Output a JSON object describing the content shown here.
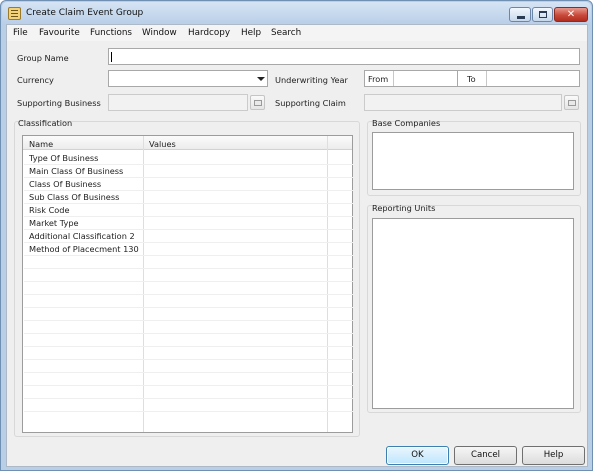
{
  "window": {
    "title": "Create Claim Event Group",
    "controls": {
      "minimize_icon": "minimize-icon",
      "maximize_icon": "maximize-icon",
      "close_icon": "close-icon"
    }
  },
  "menu": [
    "File",
    "Favourite",
    "Functions",
    "Window",
    "Hardcopy",
    "Help",
    "Search"
  ],
  "form": {
    "group_name_label": "Group Name",
    "group_name_value": "",
    "currency_label": "Currency",
    "currency_value": "",
    "underwriting_year_label": "Underwriting Year",
    "from_label": "From",
    "from_value": "",
    "to_label": "To",
    "to_value": "",
    "supporting_business_label": "Supporting Business",
    "supporting_claim_label": "Supporting Claim"
  },
  "classification": {
    "title": "Classification",
    "columns": [
      "Name",
      "Values"
    ],
    "rows": [
      {
        "name": "Type Of Business",
        "value": ""
      },
      {
        "name": "Main Class Of Business",
        "value": ""
      },
      {
        "name": "Class Of Business",
        "value": ""
      },
      {
        "name": "Sub Class Of Business",
        "value": ""
      },
      {
        "name": "Risk Code",
        "value": ""
      },
      {
        "name": "Market Type",
        "value": ""
      },
      {
        "name": "Additional Classification 2",
        "value": ""
      },
      {
        "name": "Method of Placecment 130",
        "value": ""
      }
    ]
  },
  "base_companies": {
    "title": "Base Companies"
  },
  "reporting_units": {
    "title": "Reporting Units"
  },
  "buttons": {
    "ok": "OK",
    "cancel": "Cancel",
    "help": "Help"
  }
}
